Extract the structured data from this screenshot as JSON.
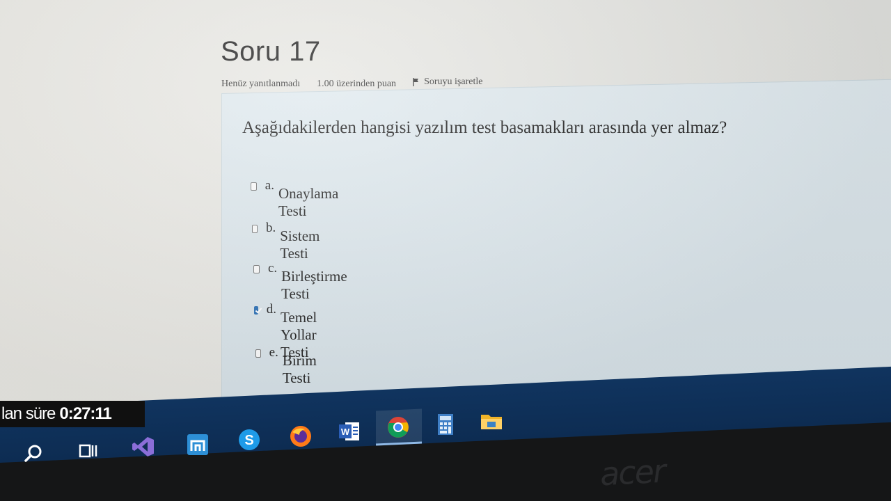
{
  "question": {
    "title": "Soru 17",
    "status": "Henüz yanıtlanmadı",
    "points": "1.00 üzerinden puan",
    "flag_label": "Soruyu işaretle",
    "text": "Aşağıdakilerden hangisi yazılım test basamakları arasında yer almaz?"
  },
  "answers": [
    {
      "letter": "a.",
      "text": "Onaylama Testi",
      "checked": false
    },
    {
      "letter": "b.",
      "text": "Sistem Testi",
      "checked": false
    },
    {
      "letter": "c.",
      "text": "Birleştirme Testi",
      "checked": false
    },
    {
      "letter": "d.",
      "text": "Temel Yollar Testi",
      "checked": true
    },
    {
      "letter": "e.",
      "text": "Birim Testi",
      "checked": false
    }
  ],
  "timer": {
    "label": "lan süre",
    "value": "0:27:11"
  },
  "taskbar": {
    "icons": [
      "search-icon",
      "task-view-icon",
      "visual-studio-icon",
      "app-icon",
      "skype-icon",
      "firefox-icon",
      "word-icon",
      "chrome-icon",
      "calculator-icon",
      "file-explorer-icon"
    ],
    "active": "chrome-icon"
  },
  "bezel_brand": "acer",
  "colors": {
    "question_bg": "#dfe9ee",
    "taskbar": "#10345f",
    "checkbox_checked": "#2a6fb5"
  }
}
